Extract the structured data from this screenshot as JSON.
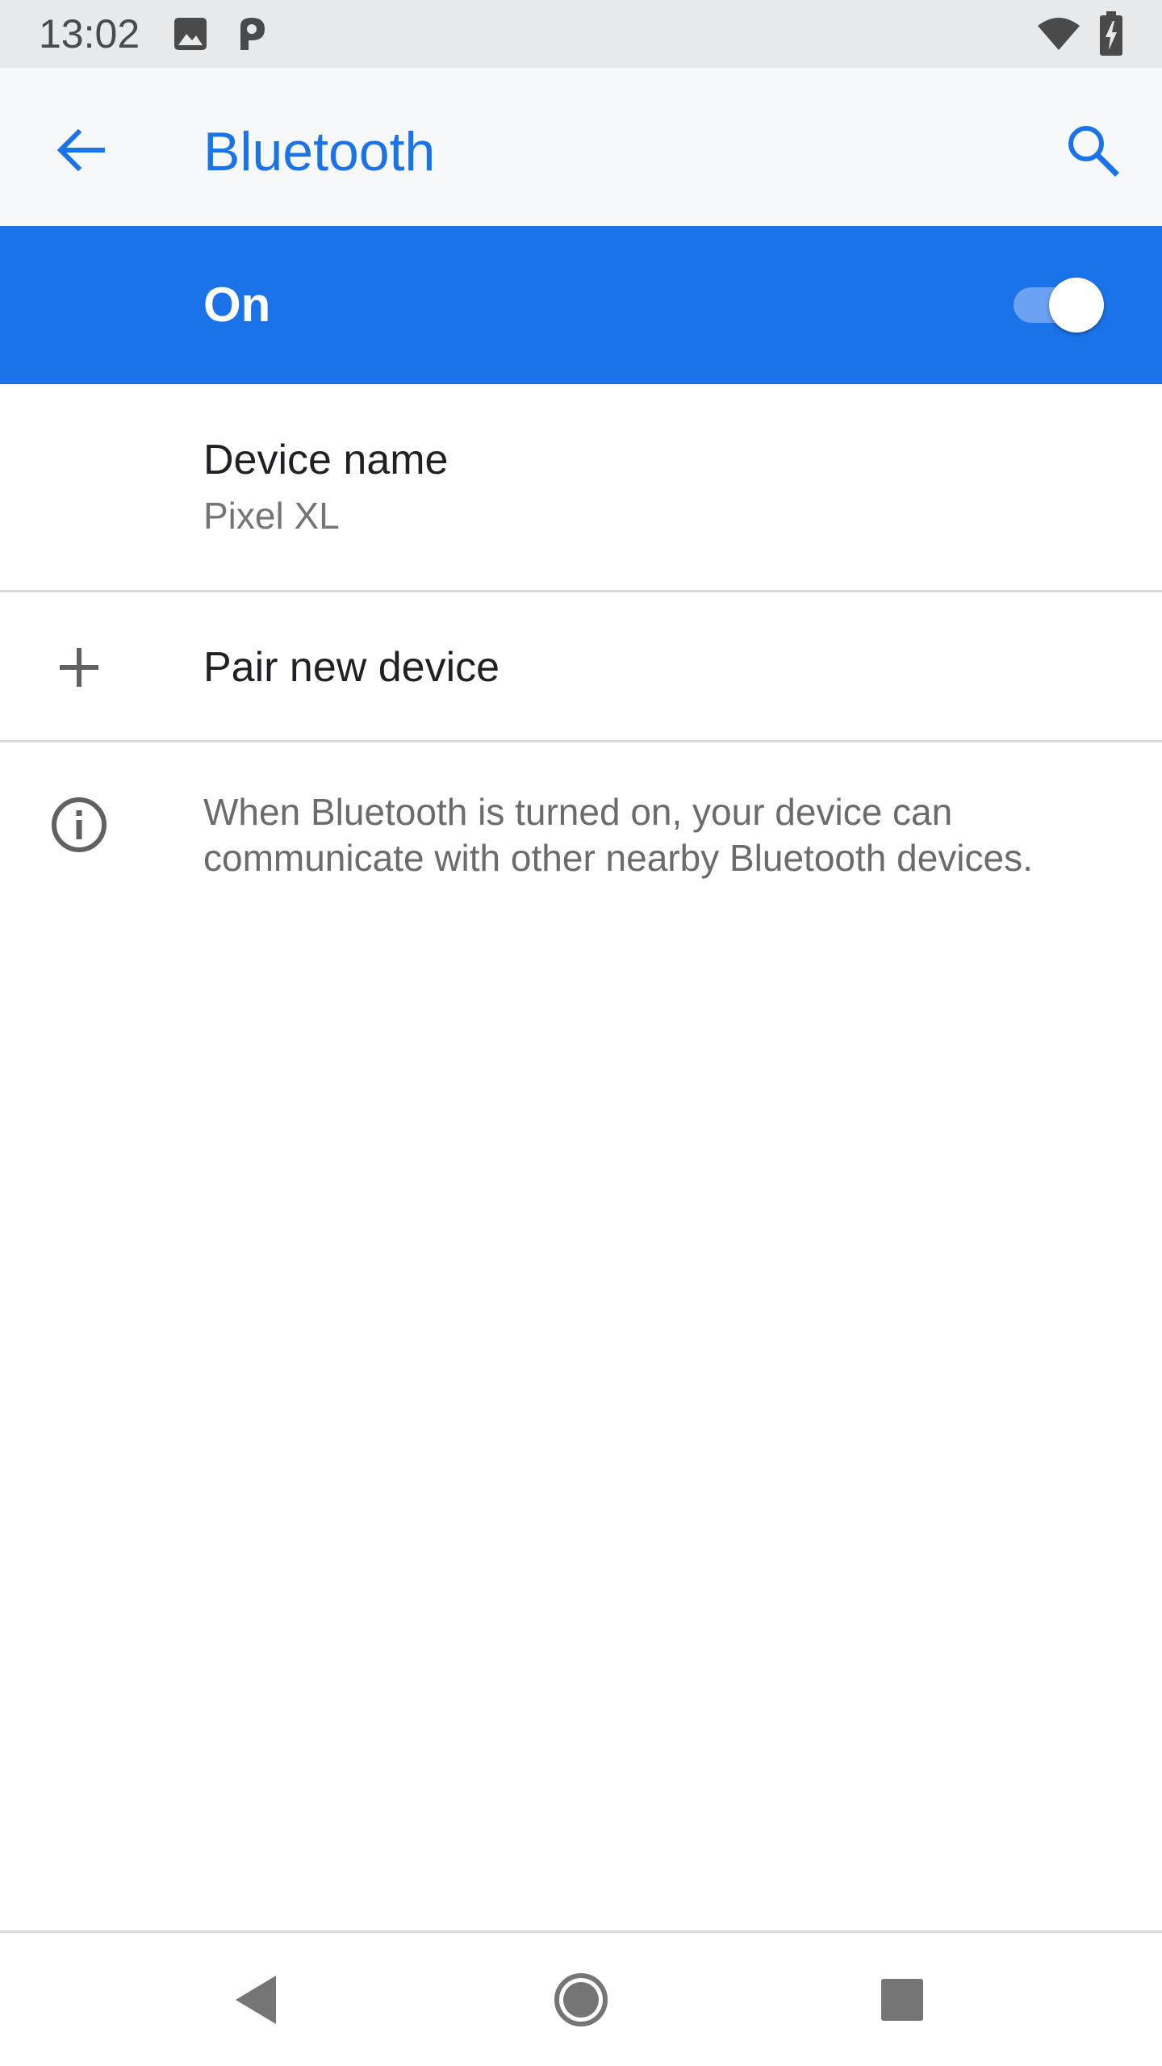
{
  "status_bar": {
    "time": "13:02",
    "icons": [
      "image-icon",
      "parking-icon",
      "wifi-icon",
      "battery-charging-icon"
    ]
  },
  "app_bar": {
    "title": "Bluetooth",
    "back_icon": "arrow-back-icon",
    "search_icon": "search-icon"
  },
  "master_switch": {
    "label": "On",
    "checked": true
  },
  "device_name": {
    "title": "Device name",
    "summary": "Pixel XL"
  },
  "pair_new_device": {
    "title": "Pair new device",
    "icon": "plus-icon"
  },
  "footer": {
    "icon": "info-icon",
    "text": "When Bluetooth is turned on, your device can communicate with other nearby Bluetooth devices."
  },
  "nav_bar": {
    "icons": [
      "nav-back-icon",
      "nav-home-icon",
      "nav-recents-icon"
    ]
  },
  "colors": {
    "accent": "#1a73e8",
    "status_bar_bg": "#e8e9eb",
    "app_bar_bg": "#f7f8f9"
  }
}
